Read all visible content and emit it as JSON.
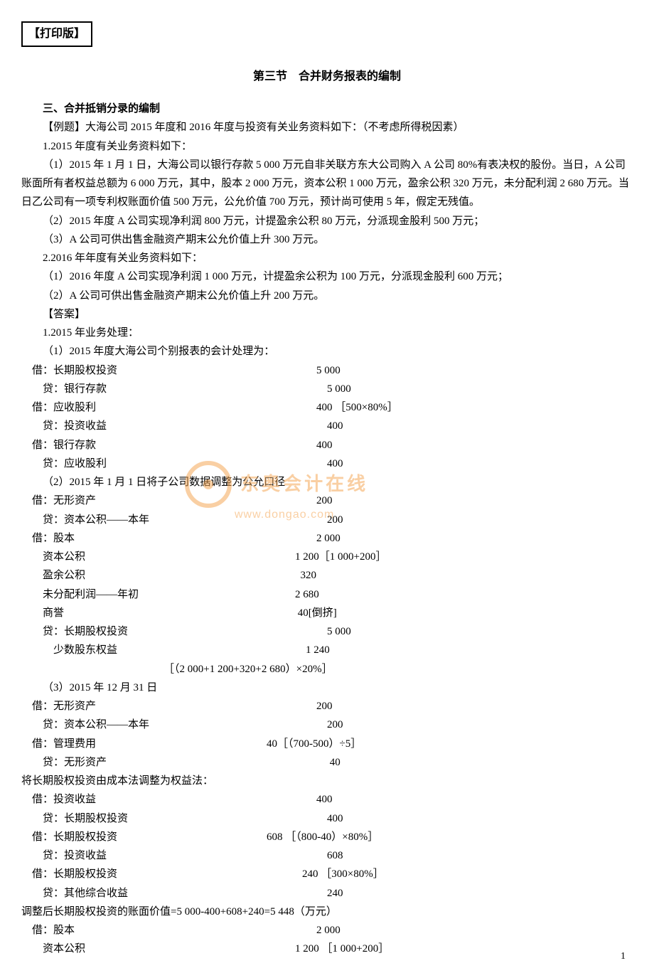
{
  "header": {
    "print_tag": "【打印版】",
    "section_title": "第三节　合并财务报表的编制"
  },
  "content": {
    "sub_title": "三、合并抵销分录的编制",
    "example_intro": "【例题】大海公司 2015 年度和 2016 年度与投资有关业务资料如下：（不考虑所得税因素）",
    "p_2015_header": "1.2015 年度有关业务资料如下：",
    "p_2015_1": "（1）2015 年 1 月 1 日，大海公司以银行存款 5 000 万元自非关联方东大公司购入 A 公司 80%有表决权的股份。当日，A 公司账面所有者权益总额为 6 000 万元，其中，股本 2 000 万元，资本公积 1 000 万元，盈余公积 320 万元，未分配利润 2 680 万元。当日乙公司有一项专利权账面价值 500 万元，公允价值 700 万元，预计尚可使用 5 年，假定无残值。",
    "p_2015_2": "（2）2015 年度 A 公司实现净利润 800 万元，计提盈余公积 80 万元，分派现金股利 500 万元；",
    "p_2015_3": "（3）A 公司可供出售金融资产期末公允价值上升 300 万元。",
    "p_2016_header": "2.2016 年年度有关业务资料如下：",
    "p_2016_1": "（1）2016 年度 A 公司实现净利润 1 000 万元，计提盈余公积为 100 万元，分派现金股利 600 万元；",
    "p_2016_2": "（2）A 公司可供出售金融资产期末公允价值上升 200 万元。",
    "answer_label": "【答案】",
    "ans_1": "1.2015 年业务处理：",
    "ans_1_1": "（1）2015 年度大海公司个别报表的会计处理为：",
    "je": [
      {
        "l": "借：长期股权投资",
        "r": "5 000",
        "i": 1
      },
      {
        "l": "  贷：银行存款",
        "r": "  5 000",
        "i": 2
      },
      {
        "l": "借：应收股利",
        "r": "400 ［500×80%］",
        "i": 1
      },
      {
        "l": "  贷：投资收益",
        "r": "  400",
        "i": 2
      },
      {
        "l": "借：银行存款",
        "r": "400",
        "i": 1
      },
      {
        "l": "  贷：应收股利",
        "r": "  400",
        "i": 2
      }
    ],
    "ans_1_2": "（2）2015 年 1 月 1 日将子公司数据调整为公允口径",
    "je2": [
      {
        "l": "借：无形资产",
        "r": "200",
        "i": 1
      },
      {
        "l": "  贷：资本公积——本年",
        "r": "  200",
        "i": 2
      },
      {
        "l": "借：股本",
        "r": "2 000",
        "i": 1
      },
      {
        "l": "    资本公积",
        "r": "1 200［1 000+200］",
        "i": 1,
        "off": 1
      },
      {
        "l": "    盈余公积",
        "r": "  320",
        "i": 1,
        "off": 1
      },
      {
        "l": "    未分配利润——年初",
        "r": "2 680",
        "i": 1,
        "off": 1
      },
      {
        "l": "    商誉",
        "r": " 40[倒挤]",
        "i": 1,
        "off": 1
      },
      {
        "l": "  贷：长期股权投资",
        "r": "  5 000",
        "i": 2
      },
      {
        "l": "      少数股东权益",
        "r": "  1 240",
        "i": 2,
        "off": 1
      }
    ],
    "calc_line": "［（2 000+1 200+320+2 680）×20%］",
    "ans_1_3": "（3）2015 年 12 月 31 日",
    "je3": [
      {
        "l": "借：无形资产",
        "r": "200",
        "i": 1
      },
      {
        "l": "  贷：资本公积——本年",
        "r": "  200",
        "i": 2
      },
      {
        "l": "借：管理费用",
        "r": "40［（700-500）÷5］",
        "i": 1,
        "off": 2
      },
      {
        "l": "  贷：无形资产",
        "r": "   40",
        "i": 2
      }
    ],
    "adj_line": "将长期股权投资由成本法调整为权益法：",
    "je4": [
      {
        "l": "借：投资收益",
        "r": "400",
        "i": 1
      },
      {
        "l": "  贷：长期股权投资",
        "r": "  400",
        "i": 2
      },
      {
        "l": "借：长期股权投资",
        "r": "608 ［（800-40）×80%］",
        "i": 1,
        "off": 2
      },
      {
        "l": "  贷：投资收益",
        "r": "  608",
        "i": 2
      },
      {
        "l": "借：长期股权投资",
        "r": "240 ［300×80%］",
        "i": 1,
        "off": 3
      },
      {
        "l": "  贷：其他综合收益",
        "r": "  240",
        "i": 2
      }
    ],
    "adj_result": "调整后长期股权投资的账面价值=5 000-400+608+240=5 448（万元）",
    "je5": [
      {
        "l": "借：股本",
        "r": "2 000",
        "i": 1
      },
      {
        "l": "    资本公积",
        "r": "1 200 ［1 000+200］",
        "i": 1,
        "off": 1
      }
    ]
  },
  "watermark": {
    "brand": "东奥会计在线",
    "url": "www.dongao.com"
  },
  "footer": {
    "page": "1"
  }
}
